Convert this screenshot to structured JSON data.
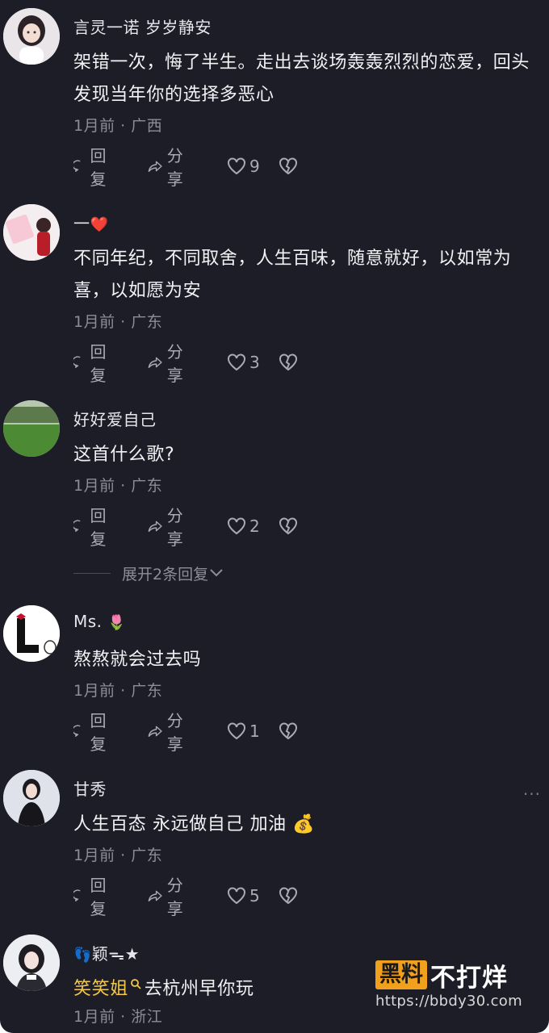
{
  "comments": [
    {
      "username": "言灵一诺 岁岁静安",
      "text": "架错一次，悔了半生。走出去谈场轰轰烈烈的恋爱，回头发现当年你的选择多恶心",
      "meta": "1月前 · 广西",
      "reply_label": "回复",
      "share_label": "分享",
      "likes": "9"
    },
    {
      "username": "一",
      "username_emoji": "❤️",
      "text": "不同年纪，不同取舍，人生百味，随意就好，以如常为喜，以如愿为安",
      "meta": "1月前 · 广东",
      "reply_label": "回复",
      "share_label": "分享",
      "likes": "3"
    },
    {
      "username": "好好爱自己",
      "text": "这首什么歌?",
      "meta": "1月前 · 广东",
      "reply_label": "回复",
      "share_label": "分享",
      "likes": "2",
      "expand_label": "展开2条回复"
    },
    {
      "username": "Ms.",
      "username_emoji": "🌷",
      "text": "熬熬就会过去吗",
      "meta": "1月前 · 广东",
      "reply_label": "回复",
      "share_label": "分享",
      "likes": "1"
    },
    {
      "username": "甘秀",
      "text": "人生百态 永远做自己  加油",
      "text_emoji": "💰",
      "meta": "1月前 · 广东",
      "reply_label": "回复",
      "share_label": "分享",
      "likes": "5",
      "more": "···"
    },
    {
      "username": "颖",
      "username_prefix_emoji": "👣",
      "username_suffix": "ᯓ★",
      "mention": "笑笑姐",
      "text": "去杭州早你玩",
      "meta": "1月前 · 浙江"
    }
  ],
  "watermark": {
    "badge": "黑料",
    "text": "不打烊",
    "url": "https://bbdy30.com"
  },
  "colors": {
    "background": "#1c1d27",
    "text": "#f2f2f5",
    "meta": "#8c8d99",
    "mention": "#f2c94c"
  }
}
